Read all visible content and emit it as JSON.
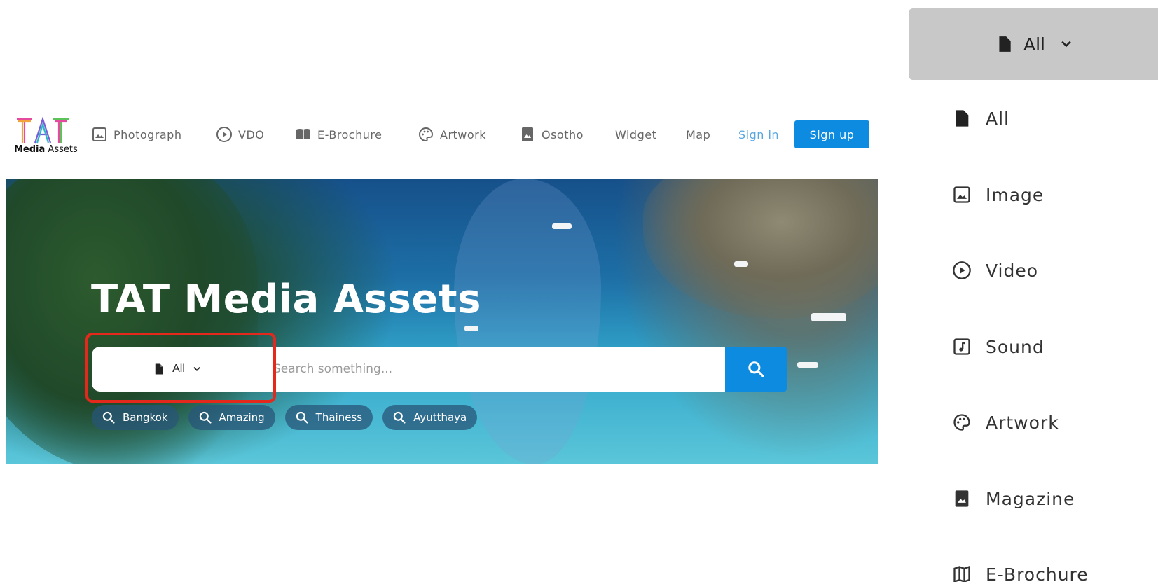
{
  "logo": {
    "title": "TAT",
    "brand_bold": "Media",
    "brand_rest": " Assets"
  },
  "nav": {
    "items": [
      {
        "label": "Photograph",
        "icon": "image-icon"
      },
      {
        "label": "VDO",
        "icon": "play-circle-icon"
      },
      {
        "label": "E-Brochure",
        "icon": "book-icon"
      },
      {
        "label": "Artwork",
        "icon": "palette-icon"
      },
      {
        "label": "Osotho",
        "icon": "magazine-icon"
      },
      {
        "label": "Widget",
        "icon": ""
      },
      {
        "label": "Map",
        "icon": ""
      }
    ],
    "sign_in": "Sign in",
    "sign_up": "Sign up"
  },
  "hero": {
    "title": "TAT Media Assets",
    "search": {
      "type_selected": "All",
      "placeholder": "Search something..."
    },
    "chips": [
      "Bangkok",
      "Amazing",
      "Thainess",
      "Ayutthaya"
    ]
  },
  "dropdown": {
    "selected": "All",
    "options": [
      {
        "label": "All",
        "icon": "file-icon"
      },
      {
        "label": "Image",
        "icon": "image-icon"
      },
      {
        "label": "Video",
        "icon": "play-circle-icon"
      },
      {
        "label": "Sound",
        "icon": "music-icon"
      },
      {
        "label": "Artwork",
        "icon": "palette-icon"
      },
      {
        "label": "Magazine",
        "icon": "magazine-icon"
      },
      {
        "label": "E-Brochure",
        "icon": "map-icon"
      }
    ]
  },
  "colors": {
    "accent": "#0d8be0",
    "highlight": "#e5281c",
    "signin": "#5aa6df",
    "dropdown_header": "#c8c8c8"
  }
}
